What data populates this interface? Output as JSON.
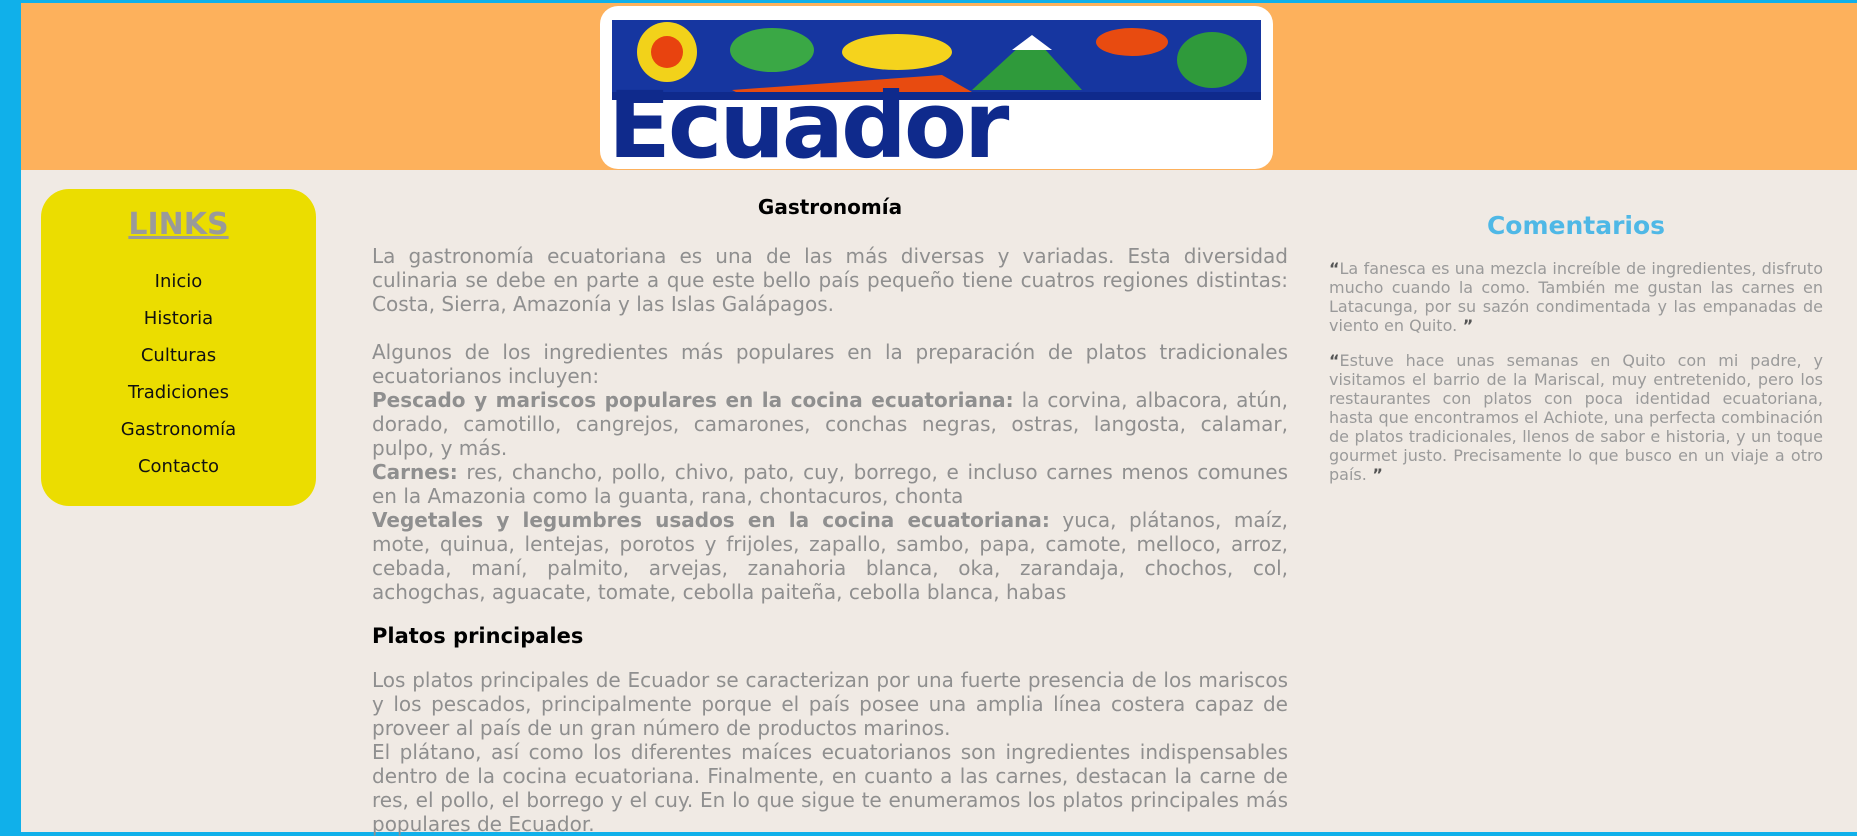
{
  "header": {
    "logo_text": "Ecuador",
    "logo_alt": "Ecuador logo"
  },
  "sidebar": {
    "title": "LINKS",
    "items": [
      {
        "label": "Inicio"
      },
      {
        "label": "Historia"
      },
      {
        "label": "Culturas"
      },
      {
        "label": "Tradiciones"
      },
      {
        "label": "Gastronomía"
      },
      {
        "label": "Contacto"
      }
    ]
  },
  "main": {
    "title": "Gastronomía",
    "p1": "La gastronomía ecuatoriana es una de las más diversas y variadas. Esta diversidad culinaria se debe en parte a que este bello país pequeño tiene cuatros regiones distintas: Costa, Sierra, Amazonía y las Islas Galápagos.",
    "p2": "Algunos de los ingredientes más populares en la preparación de platos tradicionales ecuatorianos incluyen:",
    "seafood_label": "Pescado y mariscos populares en la cocina ecuatoriana:",
    "seafood_text": " la corvina, albacora, atún, dorado, camotillo, cangrejos, camarones, conchas negras, ostras, langosta, calamar, pulpo, y más.",
    "meat_label": "Carnes:",
    "meat_text": " res, chancho, pollo, chivo, pato, cuy, borrego, e incluso carnes menos comunes en la Amazonia como la guanta, rana, chontacuros, chonta",
    "veg_label": "Vegetales y legumbres usados en la cocina ecuatoriana:",
    "veg_text": " yuca, plátanos, maíz, mote, quinua, lentejas, porotos y frijoles, zapallo, sambo, papa, camote, melloco, arroz, cebada, maní, palmito, arvejas, zanahoria blanca, oka, zarandaja, chochos, col, achogchas, aguacate, tomate, cebolla paiteña, cebolla blanca, habas",
    "subtitle": "Platos principales",
    "p3": "Los platos principales de Ecuador se caracterizan por una fuerte presencia de los mariscos y los pescados, principalmente porque el país posee una amplia línea costera capaz de proveer al país de un gran número de productos marinos.",
    "p4": "El plátano, así como los diferentes maíces ecuatorianos son ingredientes indispensables dentro de la cocina ecuatoriana. Finalmente, en cuanto a las carnes, destacan la carne de res, el pollo, el borrego y el cuy. En lo que sigue te enumeramos los platos principales más populares de Ecuador."
  },
  "comments": {
    "title": "Comentarios",
    "open_quote": "“",
    "close_quote": " ”",
    "items": [
      {
        "text": "La fanesca es una mezcla increíble de ingredientes, disfruto mucho cuando la como. También me gustan las carnes en Latacunga, por su sazón condimentada y las empanadas de viento en Quito."
      },
      {
        "text": "Estuve hace unas semanas en Quito con mi padre, y visitamos el barrio de la Mariscal, muy entretenido, pero los restaurantes con platos con poca identidad ecuatoriana, hasta que encontramos el Achiote, una perfecta combinación de platos tradicionales, llenos de sabor e historia, y un toque gourmet justo. Precisamente lo que busco en un viaje a otro país."
      }
    ]
  },
  "colors": {
    "side_border": "#10b0ea",
    "header_bg": "#fdb15c",
    "page_bg": "#f0eae4",
    "sidebar_bg": "#ebdd00",
    "comments_title": "#4fb8e6"
  }
}
